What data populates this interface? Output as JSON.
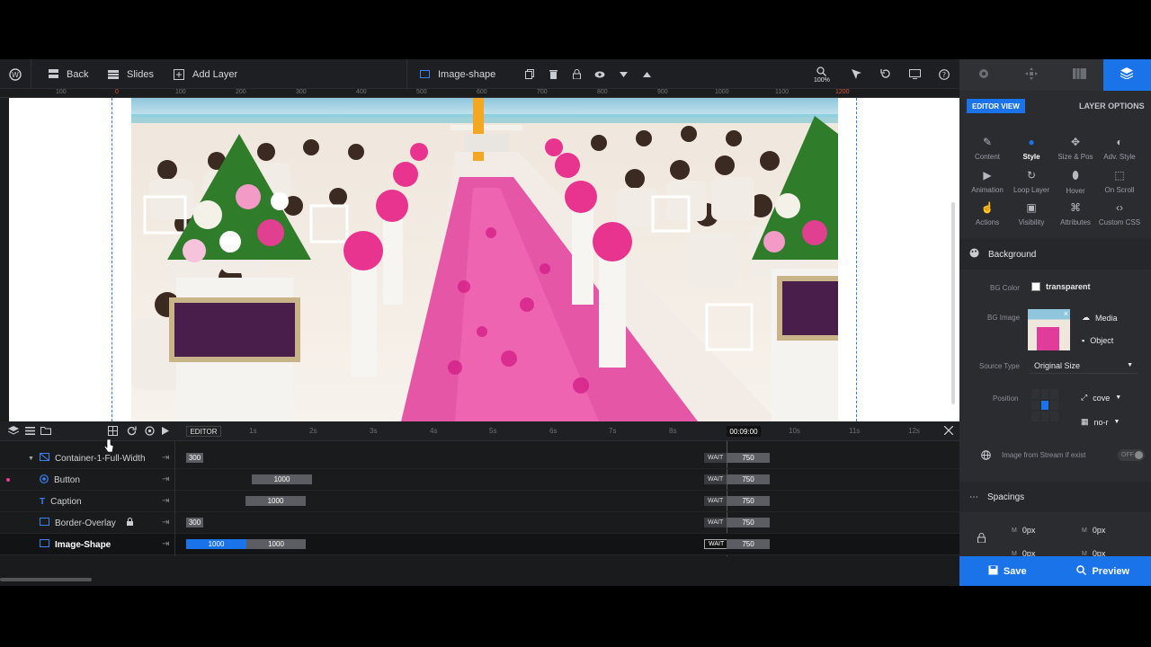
{
  "topbar": {
    "back": "Back",
    "slides": "Slides",
    "add_layer": "Add Layer",
    "layer_name": "Image-shape",
    "zoom": "100%"
  },
  "ruler": {
    "ticks": [
      "100",
      "0",
      "100",
      "200",
      "300",
      "400",
      "500",
      "600",
      "700",
      "800",
      "900",
      "1000",
      "1100",
      "1200"
    ]
  },
  "timeline": {
    "editor_label": "EDITOR",
    "current_time": "00:09:00",
    "time_marks": [
      "1s",
      "2s",
      "3s",
      "4s",
      "5s",
      "6s",
      "7s",
      "8s",
      "10s",
      "11s",
      "12s"
    ],
    "layers": [
      {
        "name": "Container-1-Full-Width",
        "start": "300",
        "wait": "WAIT",
        "end": "750"
      },
      {
        "name": "Button",
        "start": "1000",
        "wait": "WAIT",
        "end": "750"
      },
      {
        "name": "Caption",
        "start": "1000",
        "wait": "WAIT",
        "end": "750"
      },
      {
        "name": "Border-Overlay",
        "start": "300",
        "wait": "WAIT",
        "end": "750"
      },
      {
        "name": "Image-Shape",
        "start": "1000",
        "start2": "1000",
        "wait": "WAIT",
        "end": "750"
      }
    ]
  },
  "panel": {
    "editor_view": "EDITOR VIEW",
    "layer_options": "LAYER OPTIONS",
    "options": [
      "Content",
      "Style",
      "Size & Pos",
      "Adv. Style",
      "Animation",
      "Loop Layer",
      "Hover",
      "On Scroll",
      "Actions",
      "Visibility",
      "Attributes",
      "Custom CSS"
    ],
    "background": {
      "title": "Background",
      "bg_color_label": "BG Color",
      "bg_color_value": "transparent",
      "bg_image_label": "BG Image",
      "media": "Media",
      "object": "Object",
      "source_type_label": "Source Type",
      "source_type_value": "Original Size",
      "position_label": "Position",
      "size_value": "cove",
      "repeat_value": "no-r",
      "stream_label": "Image from Stream if exist",
      "stream_toggle": "OFF"
    },
    "spacings": {
      "title": "Spacings",
      "m1": "0px",
      "m2": "0px",
      "m3": "0px",
      "m4": "0px"
    },
    "save": "Save",
    "preview": "Preview"
  },
  "colors": {
    "accent": "#1a73e8",
    "panel_bg": "#2a2c30",
    "topbar_bg": "#1e1f22"
  }
}
